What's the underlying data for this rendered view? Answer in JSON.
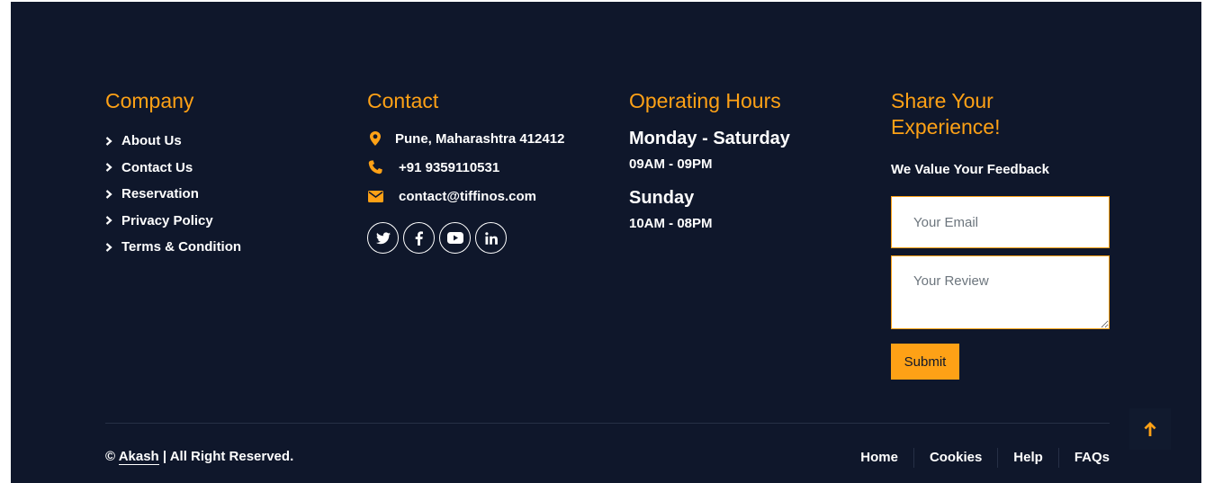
{
  "company": {
    "title": "Company",
    "links": [
      "About Us",
      "Contact Us",
      "Reservation",
      "Privacy Policy",
      "Terms & Condition"
    ]
  },
  "contact": {
    "title": "Contact",
    "address": "Pune, Maharashtra 412412",
    "phone": "+91 9359110531",
    "email": "contact@tiffinos.com",
    "socials": [
      "twitter-icon",
      "facebook-icon",
      "youtube-icon",
      "linkedin-icon"
    ]
  },
  "hours": {
    "title": "Operating Hours",
    "weekday_label": "Monday - Saturday",
    "weekday_time": "09AM - 09PM",
    "sunday_label": "Sunday",
    "sunday_time": "10AM - 08PM"
  },
  "feedback": {
    "title": "Share Your Experience!",
    "subtitle": "We Value Your Feedback",
    "email_placeholder": "Your Email",
    "review_placeholder": "Your Review",
    "submit_label": "Submit"
  },
  "bottom": {
    "copyright_symbol": "©",
    "author": "Akash",
    "rights": "| All Right Reserved.",
    "links": [
      "Home",
      "Cookies",
      "Help",
      "FAQs"
    ]
  },
  "colors": {
    "background": "#0f172b",
    "accent": "#fea116",
    "text": "#ffffff"
  }
}
